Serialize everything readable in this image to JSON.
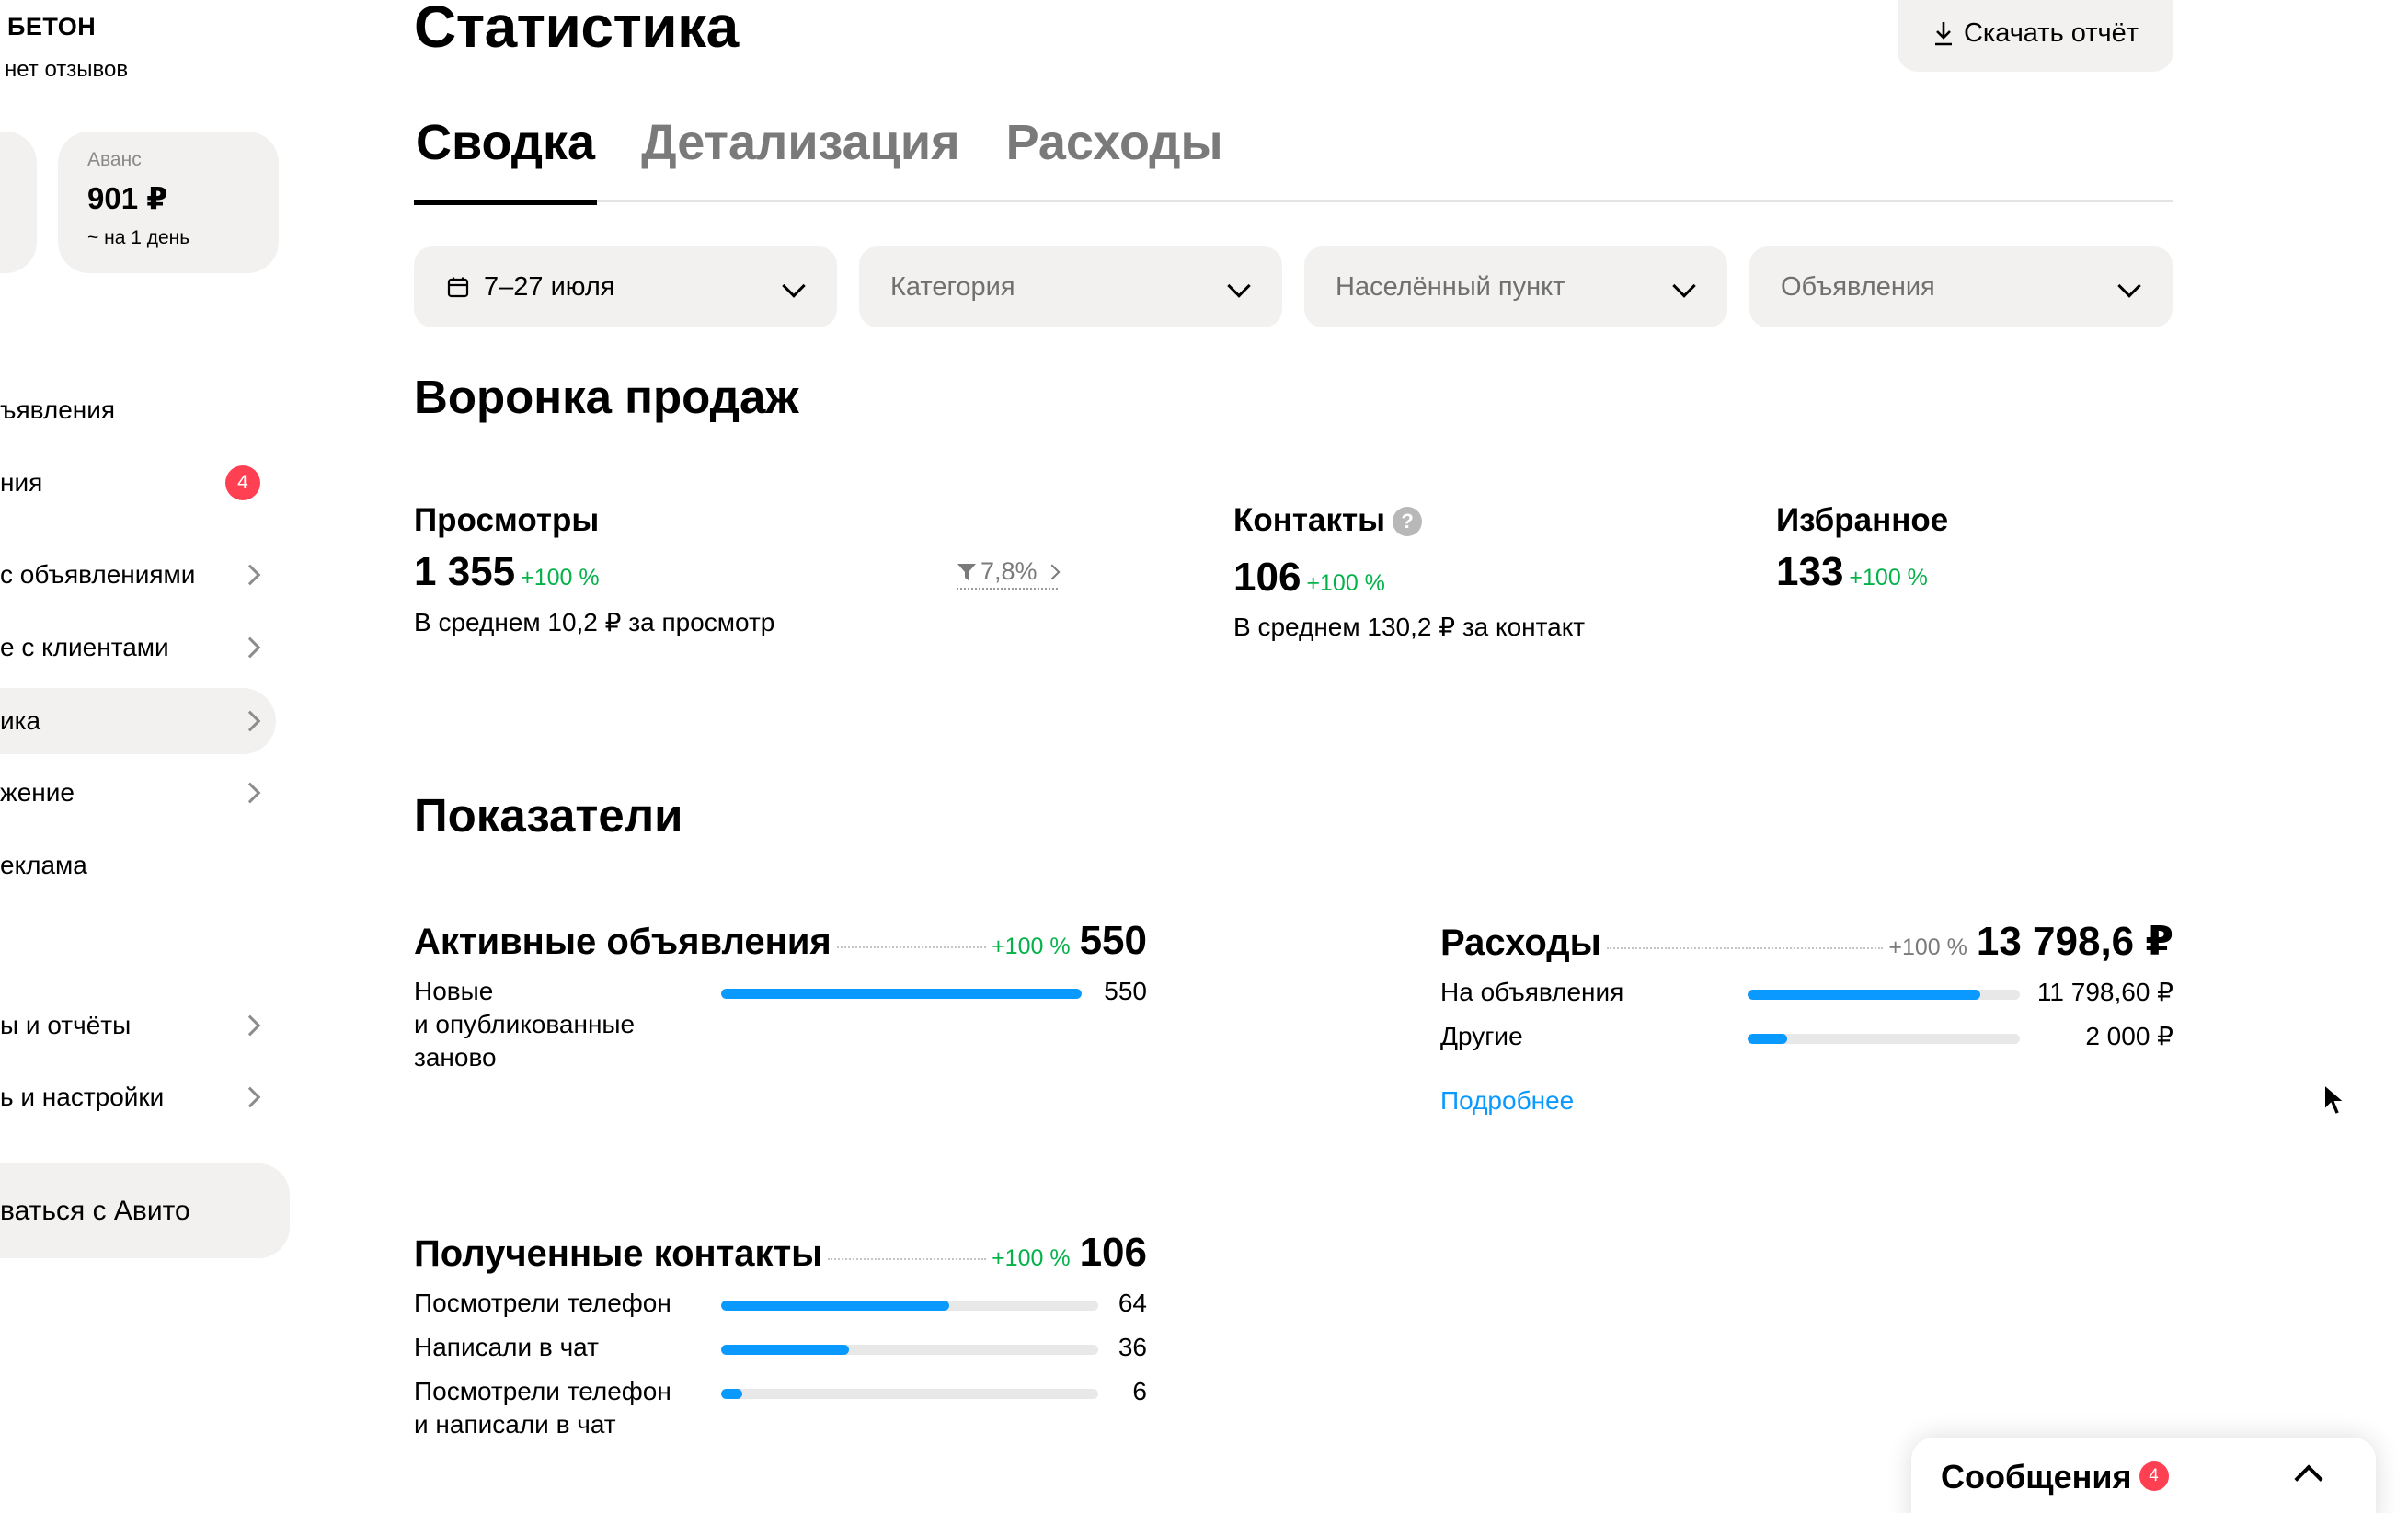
{
  "sidebar": {
    "company": "БЕТОН",
    "reviews": "нет отзывов",
    "balance": {
      "label": "Аванс",
      "amount": "901 ₽",
      "sub": "~ на 1 день"
    },
    "items": [
      {
        "label": "ъявления"
      },
      {
        "label": "ния",
        "badge": "4"
      },
      {
        "label": "с объявлениями"
      },
      {
        "label": "е с клиентами"
      },
      {
        "label": "ика"
      },
      {
        "label": "жение"
      },
      {
        "label": "еклама"
      },
      {
        "label": "ы и отчёты"
      },
      {
        "label": "ь и настройки"
      }
    ],
    "exit": "ваться с Авито"
  },
  "header": {
    "title": "Статистика",
    "download": "Скачать отчёт"
  },
  "tabs": [
    {
      "label": "Сводка",
      "active": true
    },
    {
      "label": "Детализация"
    },
    {
      "label": "Расходы"
    }
  ],
  "filters": {
    "period": "7–27 июля",
    "category": "Категория",
    "city": "Населённый пункт",
    "ads": "Объявления"
  },
  "funnel": {
    "title": "Воронка продаж",
    "views": {
      "label": "Просмотры",
      "value": "1 355",
      "delta": "+100 %",
      "sub": "В среднем 10,2 ₽ за просмотр",
      "conversion": "7,8%"
    },
    "contacts": {
      "label": "Контакты",
      "help": "?",
      "value": "106",
      "delta": "+100 %",
      "sub": "В среднем 130,2 ₽ за контакт"
    },
    "favorites": {
      "label": "Избранное",
      "value": "133",
      "delta": "+100 %"
    }
  },
  "indicators": {
    "title": "Показатели",
    "active_ads": {
      "label": "Активные объявления",
      "delta": "+100 %",
      "value": "550",
      "rows": [
        {
          "label": "Новые\nи опубликованные\nзаново",
          "value": "550",
          "fraction": 1.0
        }
      ]
    },
    "expenses": {
      "label": "Расходы",
      "delta": "+100 %",
      "value": "13 798,6 ₽",
      "rows": [
        {
          "label": "На объявления",
          "value": "11 798,60 ₽",
          "fraction": 0.855
        },
        {
          "label": "Другие",
          "value": "2 000 ₽",
          "fraction": 0.145
        }
      ],
      "more": "Подробнее"
    },
    "contacts": {
      "label": "Полученные контакты",
      "delta": "+100 %",
      "value": "106",
      "rows": [
        {
          "label": "Посмотрели телефон",
          "value": "64",
          "fraction": 0.604
        },
        {
          "label": "Написали в чат",
          "value": "36",
          "fraction": 0.34
        },
        {
          "label": "Посмотрели телефон\nи написали в чат",
          "value": "6",
          "fraction": 0.057
        }
      ]
    }
  },
  "messenger": {
    "label": "Сообщения",
    "badge": "4"
  },
  "colors": {
    "accent": "#0a99ff",
    "positive": "#04b24a",
    "badge": "#ff4053",
    "surface": "#f2f1f0"
  }
}
